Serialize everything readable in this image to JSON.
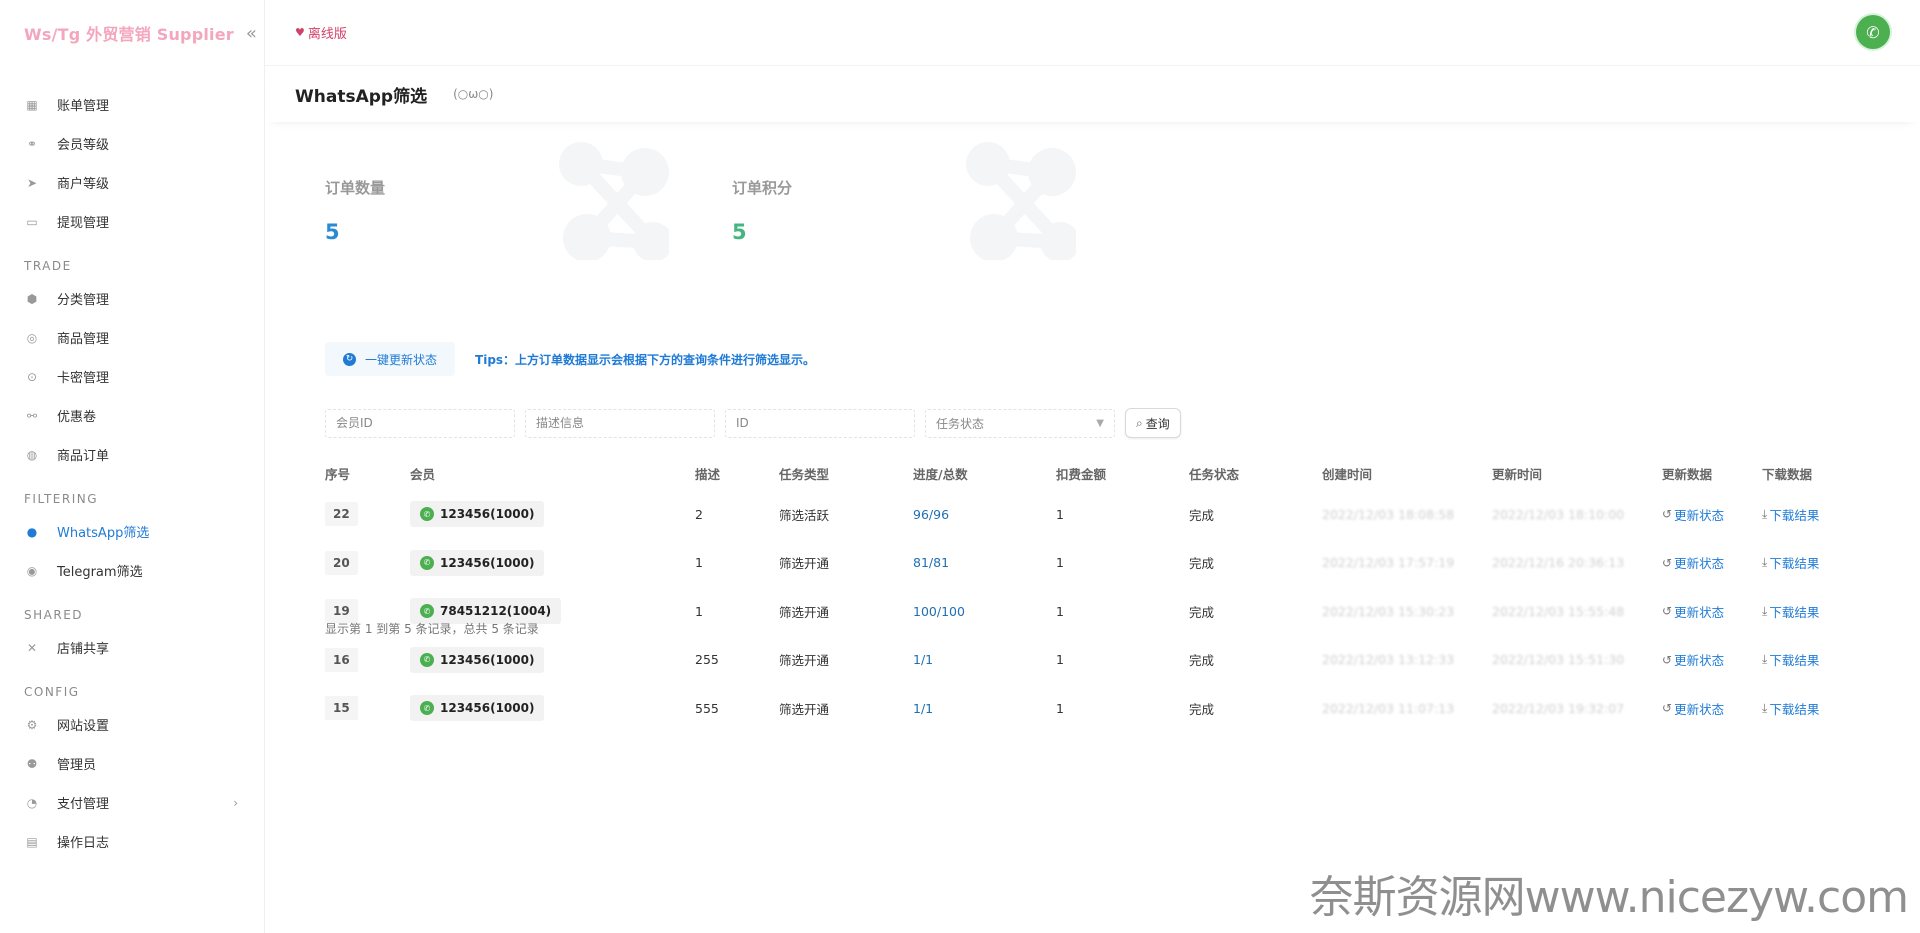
{
  "brand": {
    "title": "Ws/Tg 外贸营销 Supplier",
    "collapse_icon": "double-chevron-left-icon"
  },
  "header": {
    "offline_label": "离线版",
    "offline_icon": "location-pin-icon",
    "avatar_icon": "whatsapp-icon"
  },
  "page": {
    "title": "WhatsApp筛选",
    "kaomoji": "(○ω○)"
  },
  "sidebar": {
    "top_items": [
      {
        "label": "账单管理",
        "icon": "bill-icon"
      },
      {
        "label": "会员等级",
        "icon": "members-icon"
      },
      {
        "label": "商户等级",
        "icon": "merchant-icon"
      },
      {
        "label": "提现管理",
        "icon": "withdraw-icon"
      }
    ],
    "sections": [
      {
        "title": "TRADE",
        "items": [
          {
            "label": "分类管理",
            "icon": "category-icon"
          },
          {
            "label": "商品管理",
            "icon": "goods-icon"
          },
          {
            "label": "卡密管理",
            "icon": "card-icon"
          },
          {
            "label": "优惠卷",
            "icon": "coupon-icon"
          },
          {
            "label": "商品订单",
            "icon": "order-icon"
          }
        ]
      },
      {
        "title": "FILTERING",
        "items": [
          {
            "label": "WhatsApp筛选",
            "icon": "whatsapp-icon",
            "active": true
          },
          {
            "label": "Telegram筛选",
            "icon": "telegram-icon"
          }
        ]
      },
      {
        "title": "SHARED",
        "items": [
          {
            "label": "店铺共享",
            "icon": "share-icon"
          }
        ]
      },
      {
        "title": "CONFIG",
        "items": [
          {
            "label": "网站设置",
            "icon": "settings-icon"
          },
          {
            "label": "管理员",
            "icon": "admin-icon"
          },
          {
            "label": "支付管理",
            "icon": "payment-icon",
            "has_children": true
          },
          {
            "label": "操作日志",
            "icon": "log-icon"
          }
        ]
      }
    ]
  },
  "stats": [
    {
      "label": "订单数量",
      "value": "5",
      "color": "#2a8bd2"
    },
    {
      "label": "订单积分",
      "value": "5",
      "color": "#42b880"
    }
  ],
  "toolbar": {
    "refresh_all_label": "一键更新状态",
    "tips": "Tips：上方订单数据显示会根据下方的查询条件进行筛选显示。"
  },
  "filters": {
    "member_id_placeholder": "会员ID",
    "desc_placeholder": "描述信息",
    "id_placeholder": "ID",
    "status_placeholder": "任务状态",
    "search_label": "查询"
  },
  "table": {
    "headers": [
      "序号",
      "会员",
      "描述",
      "任务类型",
      "进度/总数",
      "扣费金额",
      "任务状态",
      "创建时间",
      "更新时间",
      "更新数据",
      "下载数据"
    ],
    "rows": [
      {
        "id": "22",
        "member": "123456(1000)",
        "desc": "2",
        "type": "筛选活跃",
        "progress": "96/96",
        "fee": "1",
        "status": "完成",
        "created": "2022/12/03 18:08:58",
        "updated": "2022/12/03 18:10:00",
        "refresh": "更新状态",
        "download": "下载结果"
      },
      {
        "id": "20",
        "member": "123456(1000)",
        "desc": "1",
        "type": "筛选开通",
        "progress": "81/81",
        "fee": "1",
        "status": "完成",
        "created": "2022/12/03 17:57:19",
        "updated": "2022/12/16 20:36:13",
        "refresh": "更新状态",
        "download": "下载结果"
      },
      {
        "id": "19",
        "member": "78451212(1004)",
        "desc": "1",
        "type": "筛选开通",
        "progress": "100/100",
        "fee": "1",
        "status": "完成",
        "created": "2022/12/03 15:30:23",
        "updated": "2022/12/03 15:55:48",
        "refresh": "更新状态",
        "download": "下载结果"
      },
      {
        "id": "16",
        "member": "123456(1000)",
        "desc": "255",
        "type": "筛选开通",
        "progress": "1/1",
        "fee": "1",
        "status": "完成",
        "created": "2022/12/03 13:12:33",
        "updated": "2022/12/03 15:51:30",
        "refresh": "更新状态",
        "download": "下载结果"
      },
      {
        "id": "15",
        "member": "123456(1000)",
        "desc": "555",
        "type": "筛选开通",
        "progress": "1/1",
        "fee": "1",
        "status": "完成",
        "created": "2022/12/03 11:07:13",
        "updated": "2022/12/03 19:32:07",
        "refresh": "更新状态",
        "download": "下载结果"
      }
    ],
    "summary": "显示第 1 到第 5 条记录，总共 5 条记录"
  },
  "watermark": "奈斯资源网www.nicezyw.com"
}
